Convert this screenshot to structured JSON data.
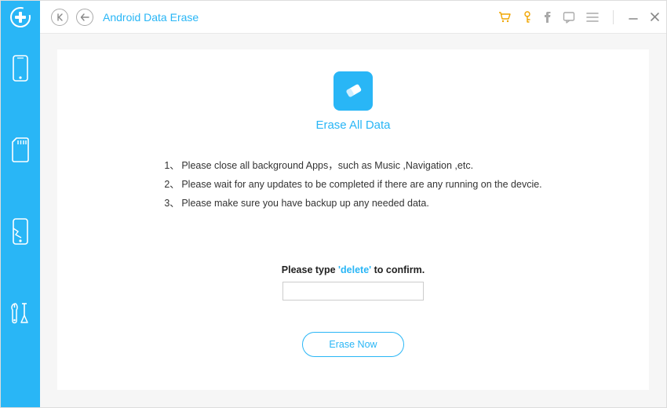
{
  "header": {
    "title": "Android Data Erase"
  },
  "main": {
    "title": "Erase All Data",
    "instructions": [
      "Please close all background Apps，such as Music ,Navigation ,etc.",
      "Please wait for any updates to be completed if there are any running on the devcie.",
      "Please make sure you have backup up any needed data."
    ],
    "confirm_prefix": "Please type",
    "confirm_keyword": " 'delete' ",
    "confirm_suffix": " to confirm.",
    "button_label": "Erase Now"
  }
}
